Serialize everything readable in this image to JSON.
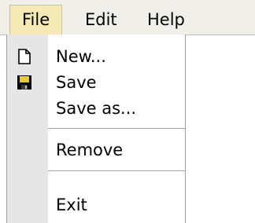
{
  "menubar": {
    "items": [
      {
        "label": "File"
      },
      {
        "label": "Edit"
      },
      {
        "label": "Help"
      }
    ]
  },
  "dropdown": {
    "items": [
      {
        "label": "New...",
        "icon": "new-document-icon"
      },
      {
        "label": "Save",
        "icon": "floppy-disk-icon"
      },
      {
        "label": "Save as...",
        "icon": ""
      },
      {
        "label": "Remove",
        "icon": ""
      },
      {
        "label": "Exit",
        "icon": ""
      }
    ]
  },
  "colors": {
    "menubar_bg": "#f0efe9",
    "active_menu_bg": "#f5e9b5",
    "gutter_bg": "#e6e6e6",
    "separator": "#a7a7a7"
  }
}
